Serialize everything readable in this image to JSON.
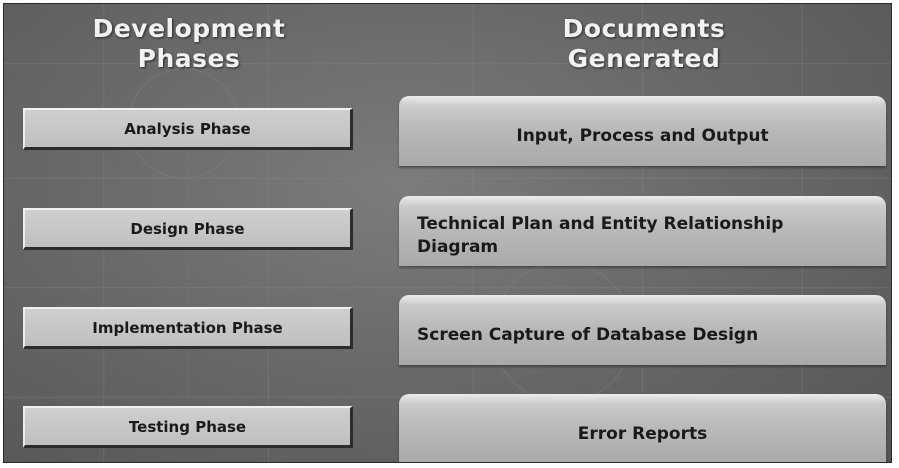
{
  "headers": {
    "left": [
      "Development",
      "Phases"
    ],
    "right": [
      "Documents",
      "Generated"
    ]
  },
  "phases": [
    {
      "label": "Analysis Phase"
    },
    {
      "label": "Design Phase"
    },
    {
      "label": "Implementation Phase"
    },
    {
      "label": "Testing Phase"
    }
  ],
  "documents": [
    {
      "label": "Input, Process and Output"
    },
    {
      "label": "Technical Plan and Entity Relationship Diagram"
    },
    {
      "label": "Screen Capture of Database Design"
    },
    {
      "label": "Error Reports"
    }
  ],
  "colors": {
    "background": "#6b6b6b",
    "header_text": "#f2f2f2",
    "box_fill": "#c4c4c4",
    "box_text": "#1a1a1a"
  }
}
